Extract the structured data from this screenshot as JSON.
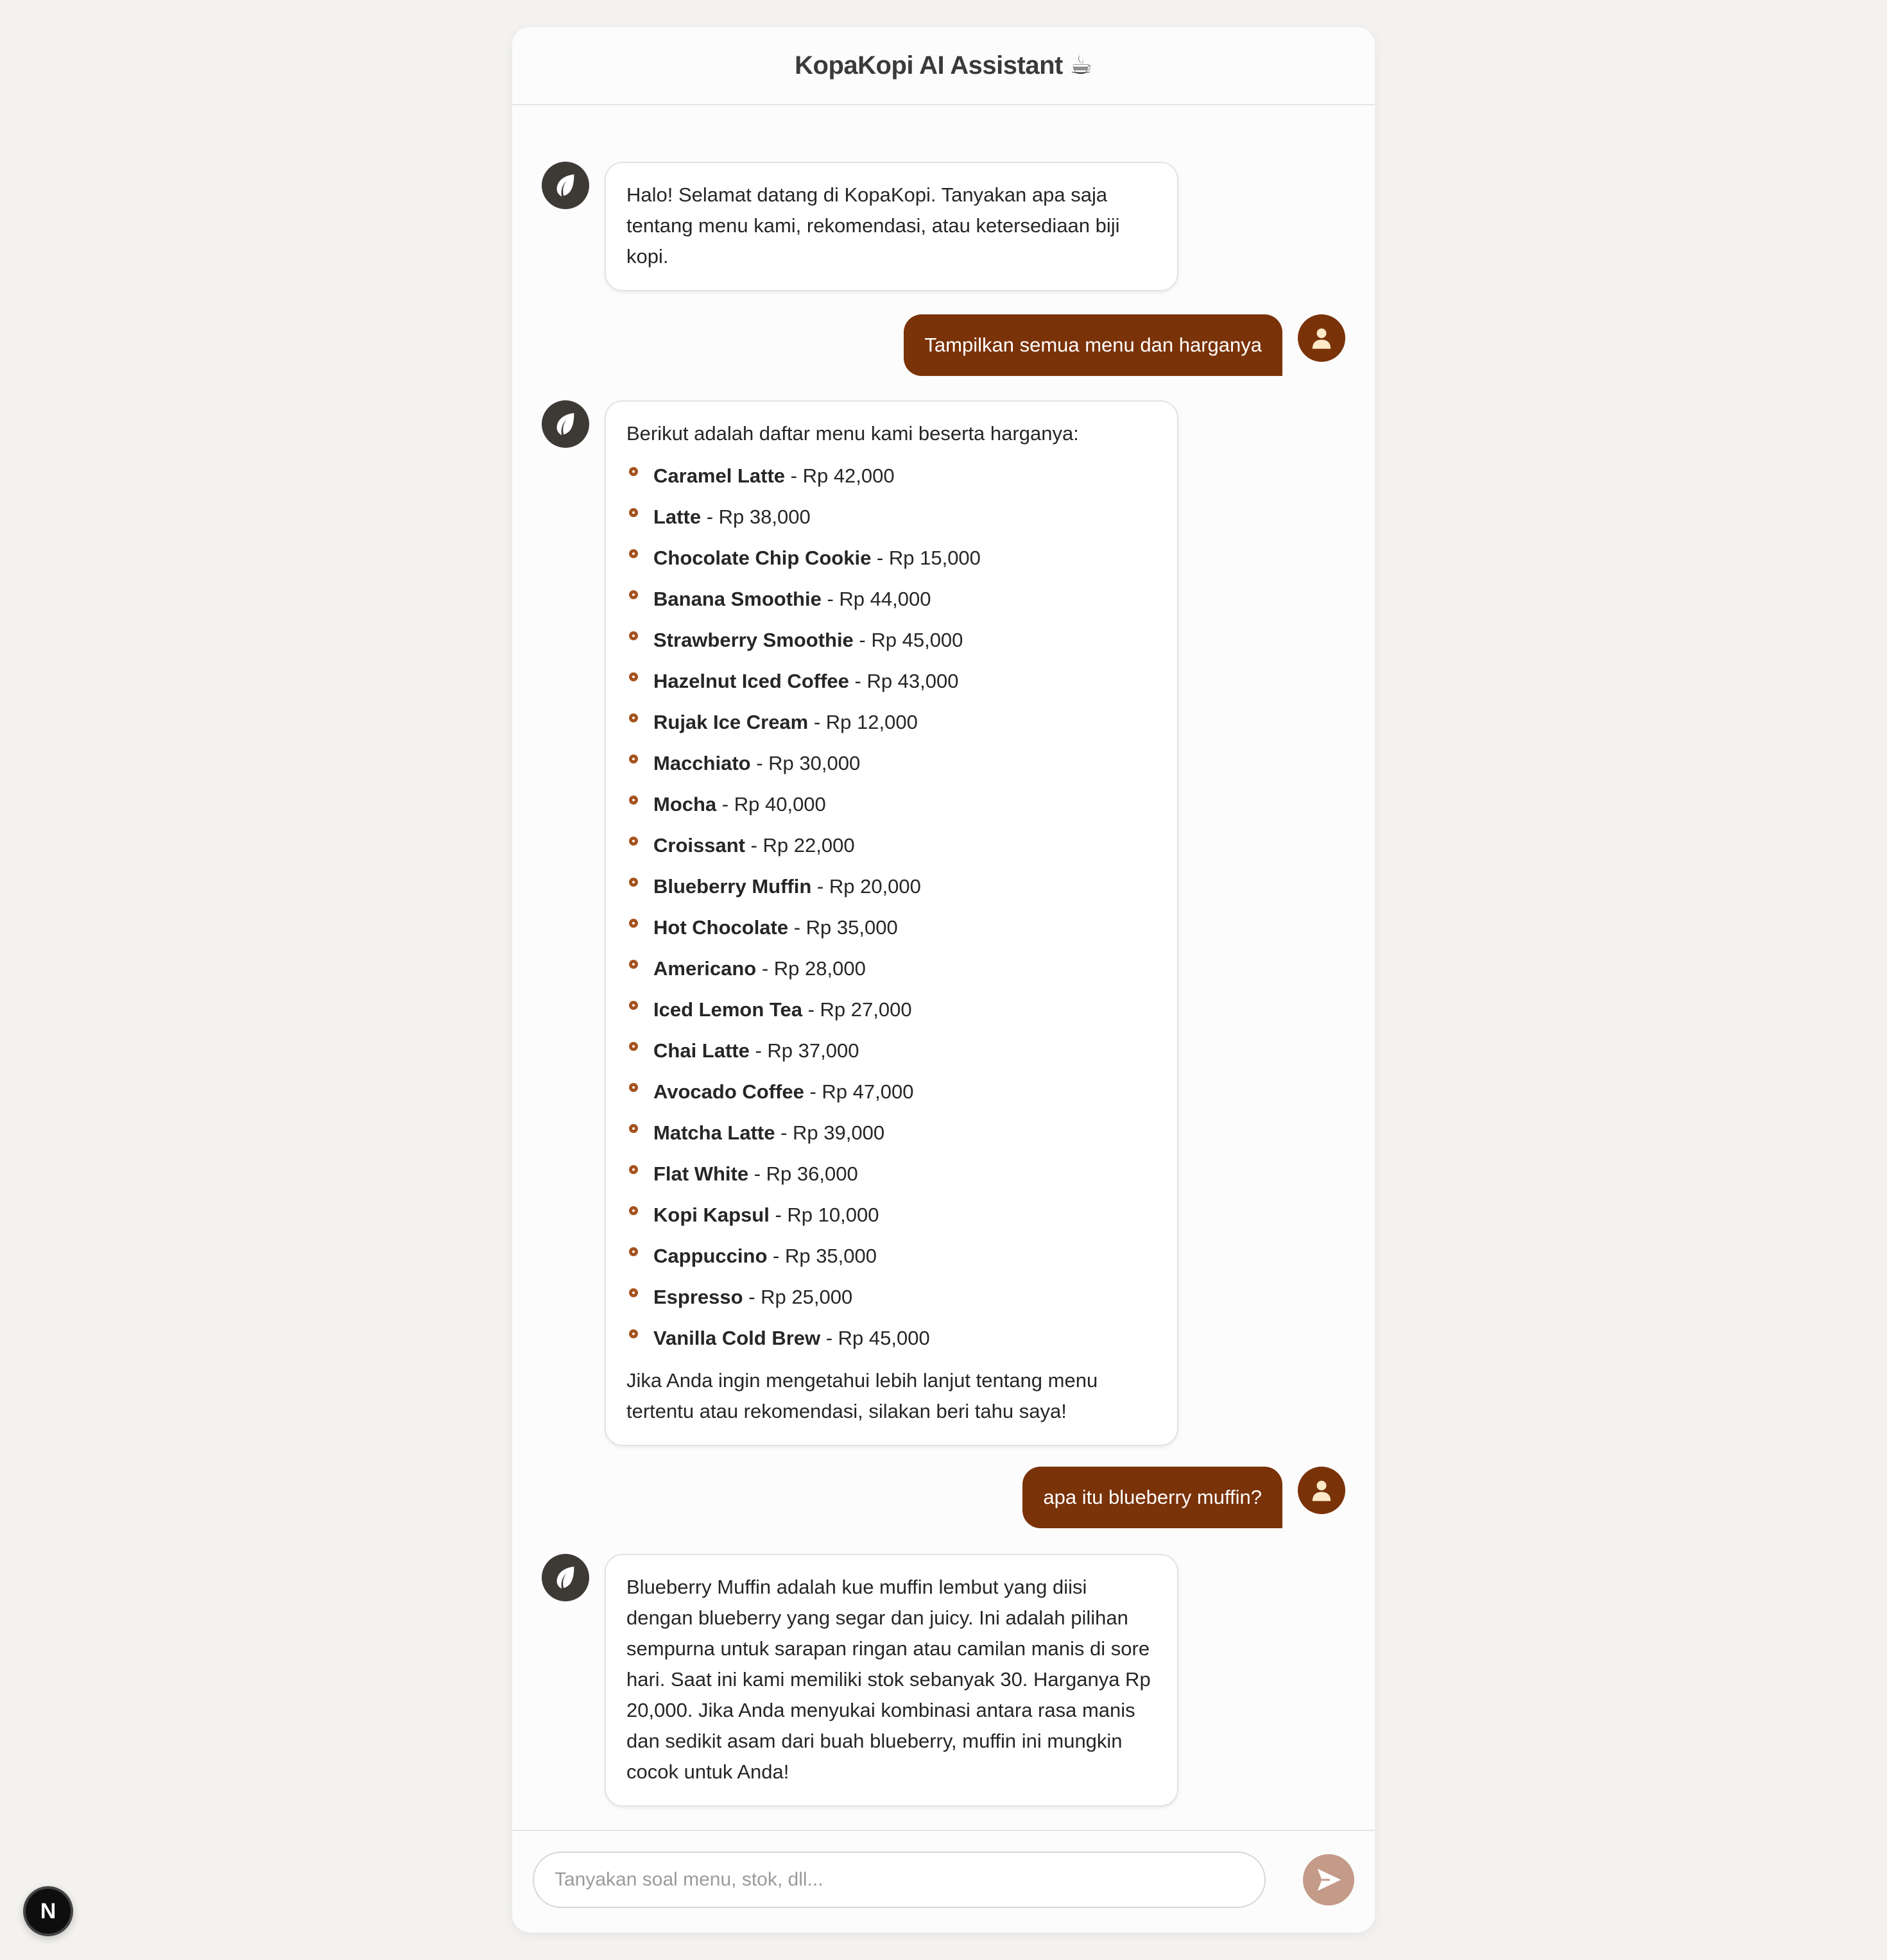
{
  "header": {
    "title": "KopaKopi AI Assistant ☕"
  },
  "messages": [
    {
      "role": "assistant",
      "text": "Halo! Selamat datang di KopaKopi. Tanyakan apa saja tentang menu kami, rekomendasi, atau ketersediaan biji kopi."
    },
    {
      "role": "user",
      "text": "Tampilkan semua menu dan harganya"
    },
    {
      "role": "assistant",
      "intro": "Berikut adalah daftar menu kami beserta harganya:",
      "items": [
        {
          "name": "Caramel Latte",
          "price": " - Rp 42,000"
        },
        {
          "name": "Latte",
          "price": " - Rp 38,000"
        },
        {
          "name": "Chocolate Chip Cookie",
          "price": " - Rp 15,000"
        },
        {
          "name": "Banana Smoothie",
          "price": " - Rp 44,000"
        },
        {
          "name": "Strawberry Smoothie",
          "price": " - Rp 45,000"
        },
        {
          "name": "Hazelnut Iced Coffee",
          "price": " - Rp 43,000"
        },
        {
          "name": "Rujak Ice Cream",
          "price": " - Rp 12,000"
        },
        {
          "name": "Macchiato",
          "price": " - Rp 30,000"
        },
        {
          "name": "Mocha",
          "price": " - Rp 40,000"
        },
        {
          "name": "Croissant",
          "price": " - Rp 22,000"
        },
        {
          "name": "Blueberry Muffin",
          "price": " - Rp 20,000"
        },
        {
          "name": "Hot Chocolate",
          "price": " - Rp 35,000"
        },
        {
          "name": "Americano",
          "price": " - Rp 28,000"
        },
        {
          "name": "Iced Lemon Tea",
          "price": " - Rp 27,000"
        },
        {
          "name": "Chai Latte",
          "price": " - Rp 37,000"
        },
        {
          "name": "Avocado Coffee",
          "price": " - Rp 47,000"
        },
        {
          "name": "Matcha Latte",
          "price": " - Rp 39,000"
        },
        {
          "name": "Flat White",
          "price": " - Rp 36,000"
        },
        {
          "name": "Kopi Kapsul",
          "price": " - Rp 10,000"
        },
        {
          "name": "Cappuccino",
          "price": " - Rp 35,000"
        },
        {
          "name": "Espresso",
          "price": " - Rp 25,000"
        },
        {
          "name": "Vanilla Cold Brew",
          "price": " - Rp 45,000"
        }
      ],
      "outro": "Jika Anda ingin mengetahui lebih lanjut tentang menu tertentu atau rekomendasi, silakan beri tahu saya!"
    },
    {
      "role": "user",
      "text": "apa itu blueberry muffin?"
    },
    {
      "role": "assistant",
      "text": "Blueberry Muffin adalah kue muffin lembut yang diisi dengan blueberry yang segar dan juicy. Ini adalah pilihan sempurna untuk sarapan ringan atau camilan manis di sore hari. Saat ini kami memiliki stok sebanyak 30. Harganya Rp 20,000. Jika Anda menyukai kombinasi antara rasa manis dan sedikit asam dari buah blueberry, muffin ini mungkin cocok untuk Anda!"
    }
  ],
  "input": {
    "placeholder": "Tanyakan soal menu, stok, dll...",
    "value": ""
  },
  "icons": {
    "bot_avatar": "leaf-icon",
    "user_avatar": "user-icon",
    "send": "send-arrow-icon",
    "dev_badge": "nextjs-logo"
  },
  "dev_badge": {
    "label": "N"
  },
  "colors": {
    "accent": "#7a3208",
    "bot_avatar_bg": "#3d3a36",
    "send_button": "#c49a88",
    "page_bg": "#f3f2f0"
  }
}
